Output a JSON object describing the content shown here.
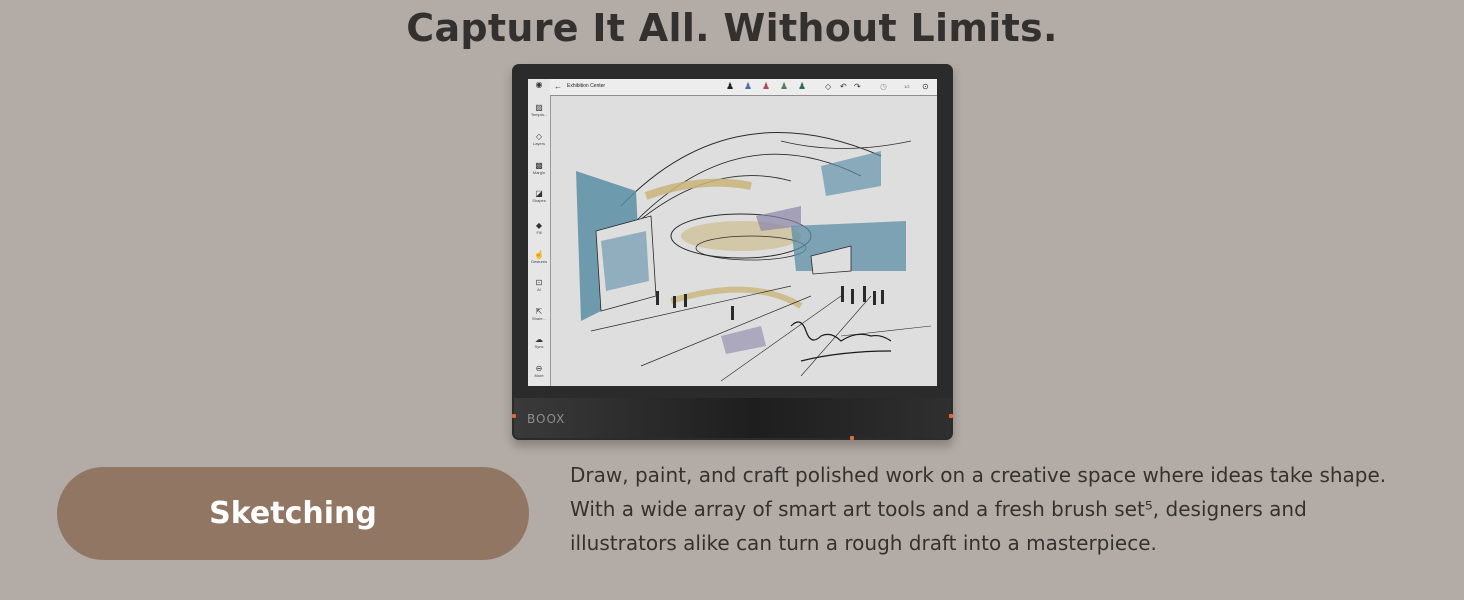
{
  "headline": "Capture It All. Without Limits.",
  "device": {
    "brand": "BOOX",
    "app": {
      "document_title": "Exhibition Center",
      "page_indicator": "1/2",
      "rail_items": [
        {
          "label": "Templa...",
          "icon": "template-icon"
        },
        {
          "label": "Layers",
          "icon": "layers-icon"
        },
        {
          "label": "Margin",
          "icon": "margin-icon"
        },
        {
          "label": "Shapes",
          "icon": "shapes-icon"
        },
        {
          "label": "Fill",
          "icon": "fill-icon"
        },
        {
          "label": "Gestures",
          "icon": "gestures-icon"
        },
        {
          "label": "AI",
          "icon": "ai-icon"
        },
        {
          "label": "Share...",
          "icon": "share-icon"
        },
        {
          "label": "Sync",
          "icon": "sync-icon"
        },
        {
          "label": "More",
          "icon": "more-icon"
        }
      ],
      "pen_colors": [
        "#222222",
        "#4a6fa0",
        "#b04a5a",
        "#5a7a50",
        "#2f6b4a"
      ],
      "toolbar_icons": [
        "eraser-icon",
        "undo-icon",
        "redo-icon",
        "history-icon",
        "next-page-icon"
      ]
    },
    "sketch_colors": {
      "blue": "#5b8ea6",
      "gold": "#c9b57a",
      "purple": "#8a86a8",
      "ink": "#2a2a2a"
    }
  },
  "feature": {
    "label": "Sketching",
    "accent": "#917664"
  },
  "description": {
    "lines": [
      "Draw, paint, and craft polished work on a creative space where ideas take shape.",
      "With a wide array of smart art tools and a fresh brush set⁵, designers and",
      "illustrators alike can turn a rough draft into a masterpiece."
    ]
  }
}
